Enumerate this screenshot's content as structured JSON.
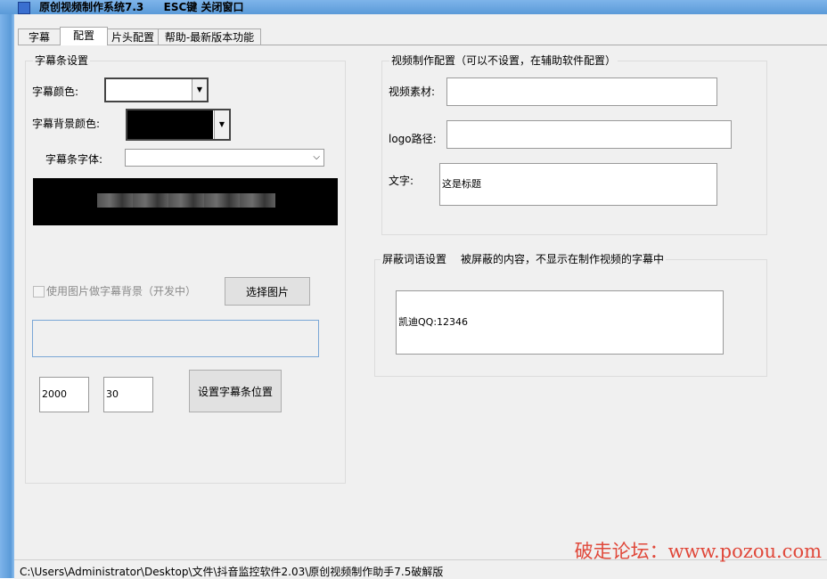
{
  "window": {
    "title": "原创视频制作系统7.3",
    "hint": "ESC键 关闭窗口"
  },
  "tabs": [
    "字幕",
    "配置",
    "片头配置",
    "帮助-最新版本功能"
  ],
  "subtitle_bar": {
    "group_title": "字幕条设置",
    "color_label": "字幕颜色:",
    "bg_color_label": "字幕背景颜色:",
    "font_label": "字幕条字体:",
    "font_value": "",
    "use_image_label": "使用图片做字幕背景（开发中）",
    "choose_image_button": "选择图片",
    "pos_x": "2000",
    "pos_y": "30",
    "set_position_button": "设置字幕条位置",
    "colors": {
      "text": "#ffffff",
      "background": "#000000"
    }
  },
  "video_config": {
    "group_title": "视频制作配置（可以不设置，在辅助软件配置）",
    "material_label": "视频素材:",
    "material_value": "",
    "logo_label": "logo路径:",
    "logo_value": "",
    "text_label": "文字:",
    "text_value": "这是标题"
  },
  "block_words": {
    "group_title": "屏蔽词语设置",
    "description": "被屏蔽的内容，不显示在制作视频的字幕中",
    "content": "凯迪QQ:12346"
  },
  "status": {
    "path": "C:\\Users\\Administrator\\Desktop\\文件\\抖音监控软件2.03\\原创视频制作助手7.5破解版"
  },
  "watermark": "破走论坛：www.pozou.com"
}
